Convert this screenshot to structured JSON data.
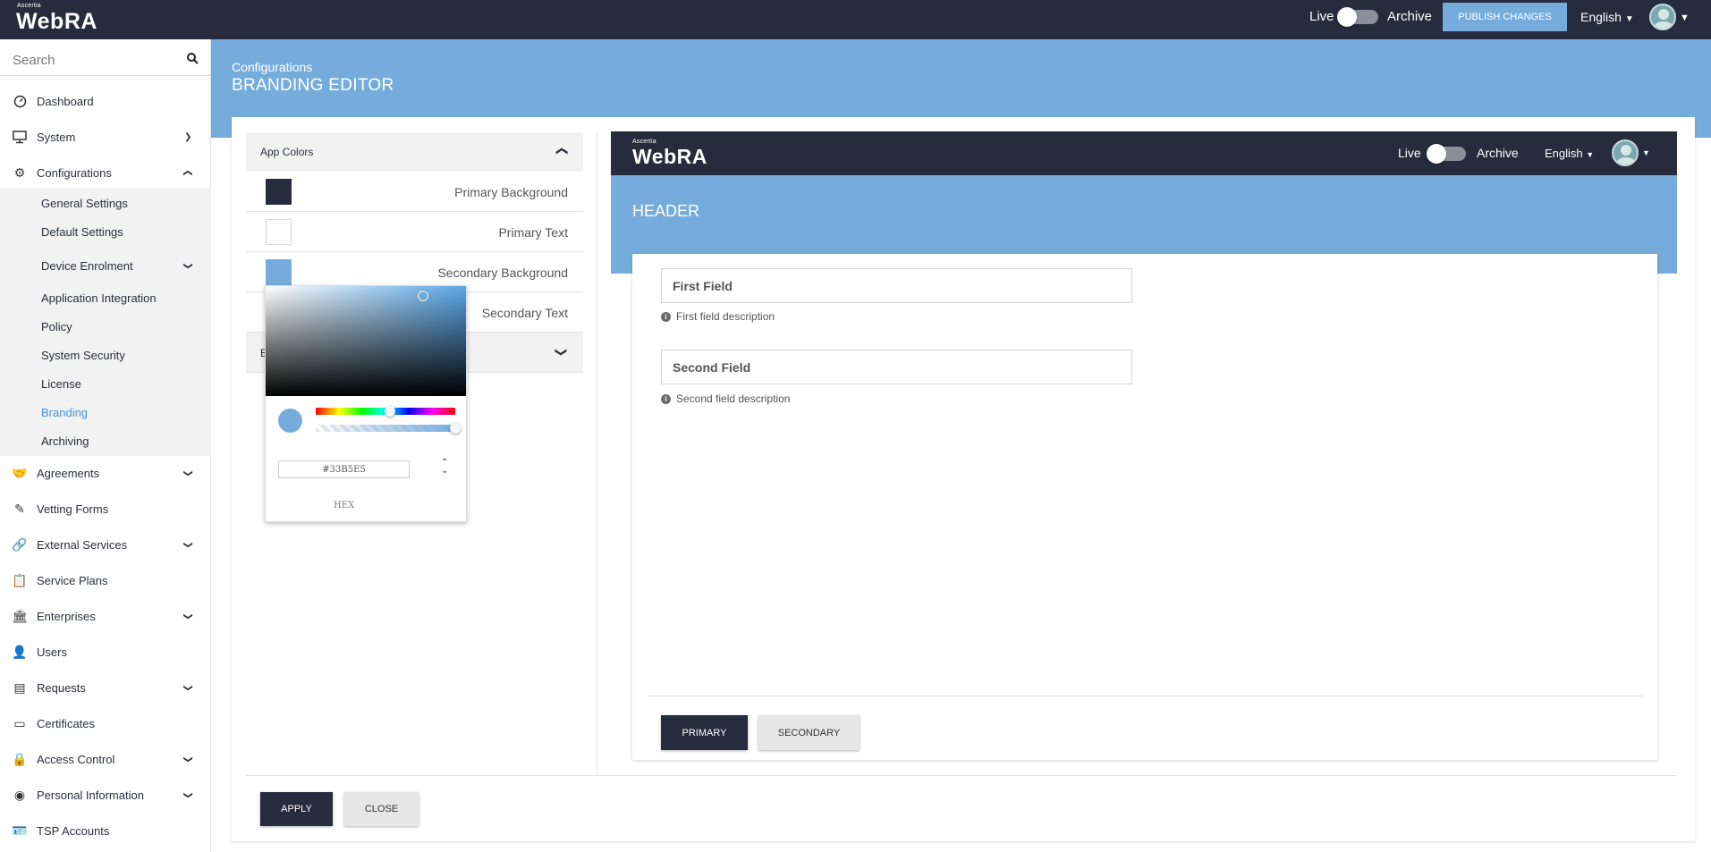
{
  "topbar": {
    "brand_small": "Ascertia",
    "brand": "WebRA",
    "live_label": "Live",
    "archive_label": "Archive",
    "publish_label": "PUBLISH CHANGES",
    "language": "English"
  },
  "sidebar": {
    "search_placeholder": "Search",
    "items": [
      {
        "label": "Dashboard",
        "icon": "dashboard-icon"
      },
      {
        "label": "System",
        "icon": "monitor-icon"
      },
      {
        "label": "Configurations",
        "icon": "gear-icon"
      },
      {
        "label": "Agreements",
        "icon": "handshake-icon"
      },
      {
        "label": "Vetting Forms",
        "icon": "form-icon"
      },
      {
        "label": "External Services",
        "icon": "link-icon"
      },
      {
        "label": "Service Plans",
        "icon": "clipboard-icon"
      },
      {
        "label": "Enterprises",
        "icon": "bank-icon"
      },
      {
        "label": "Users",
        "icon": "user-icon"
      },
      {
        "label": "Requests",
        "icon": "requests-icon"
      },
      {
        "label": "Certificates",
        "icon": "certificate-icon"
      },
      {
        "label": "Access Control",
        "icon": "lock-icon"
      },
      {
        "label": "Personal Information",
        "icon": "person-circle-icon"
      },
      {
        "label": "TSP Accounts",
        "icon": "id-card-icon"
      }
    ],
    "sub_items": [
      {
        "label": "General Settings"
      },
      {
        "label": "Default Settings"
      },
      {
        "label": "Device Enrolment"
      },
      {
        "label": "Application Integration"
      },
      {
        "label": "Policy"
      },
      {
        "label": "System Security"
      },
      {
        "label": "License"
      },
      {
        "label": "Branding"
      },
      {
        "label": "Archiving"
      }
    ]
  },
  "header": {
    "breadcrumb": "Configurations",
    "title": "BRANDING EDITOR"
  },
  "editor": {
    "section_title": "App Colors",
    "collapsed_section_initial": "B",
    "colors": [
      {
        "label": "Primary Background",
        "value": "#262B3D"
      },
      {
        "label": "Primary Text",
        "value": "#FFFFFF"
      },
      {
        "label": "Secondary Background",
        "value": "#76ACDC"
      },
      {
        "label": "Secondary Text",
        "value": ""
      }
    ],
    "picker": {
      "hex_value": "#33B5E5",
      "mode_label": "HEX",
      "hue_fraction": 0.53,
      "alpha_fraction": 1.0
    },
    "apply_label": "APPLY",
    "close_label": "CLOSE"
  },
  "preview": {
    "brand_small": "Ascertia",
    "brand": "WebRA",
    "live_label": "Live",
    "archive_label": "Archive",
    "language": "English",
    "header_title": "HEADER",
    "first_field_label": "First Field",
    "first_field_desc": "First field description",
    "second_field_label": "Second Field",
    "second_field_desc": "Second field description",
    "primary_label": "PRIMARY",
    "secondary_label": "SECONDARY"
  },
  "colors": {
    "primary_dark": "#262B3D",
    "accent_blue": "#76ACDC",
    "active_link": "#4A90D9"
  }
}
